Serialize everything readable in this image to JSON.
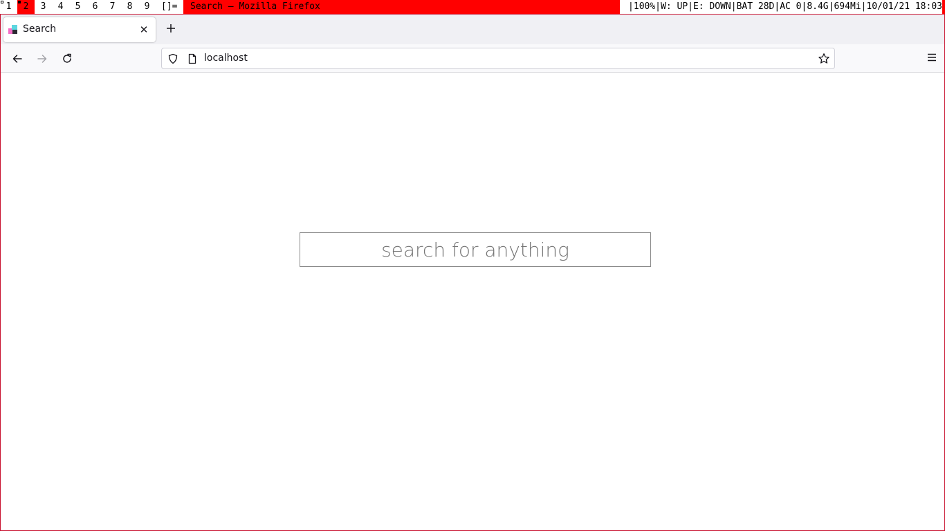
{
  "statusbar": {
    "tags": [
      "1",
      "2",
      "3",
      "4",
      "5",
      "6",
      "7",
      "8",
      "9"
    ],
    "selected_tag": "2",
    "layout_symbol": "[]=",
    "window_title": "Search — Mozilla Firefox",
    "status_text": "|100%|W: UP|E: DOWN|BAT 28D|AC 0|8.4G|694Mi|10/01/21 18:03",
    "accent_color": "#ff0000"
  },
  "browser": {
    "tab": {
      "title": "Search",
      "close_icon": "close-icon",
      "favicon": "site-favicon"
    },
    "new_tab_icon": "plus-icon",
    "nav": {
      "back_icon": "back-arrow-icon",
      "forward_icon": "forward-arrow-icon",
      "reload_icon": "reload-icon"
    },
    "urlbar": {
      "url": "localhost",
      "shield_icon": "tracking-protection-icon",
      "page_icon": "page-icon",
      "bookmark_icon": "star-icon"
    },
    "menu_icon": "hamburger-menu-icon"
  },
  "page": {
    "search": {
      "placeholder": "search for anything",
      "value": ""
    }
  }
}
